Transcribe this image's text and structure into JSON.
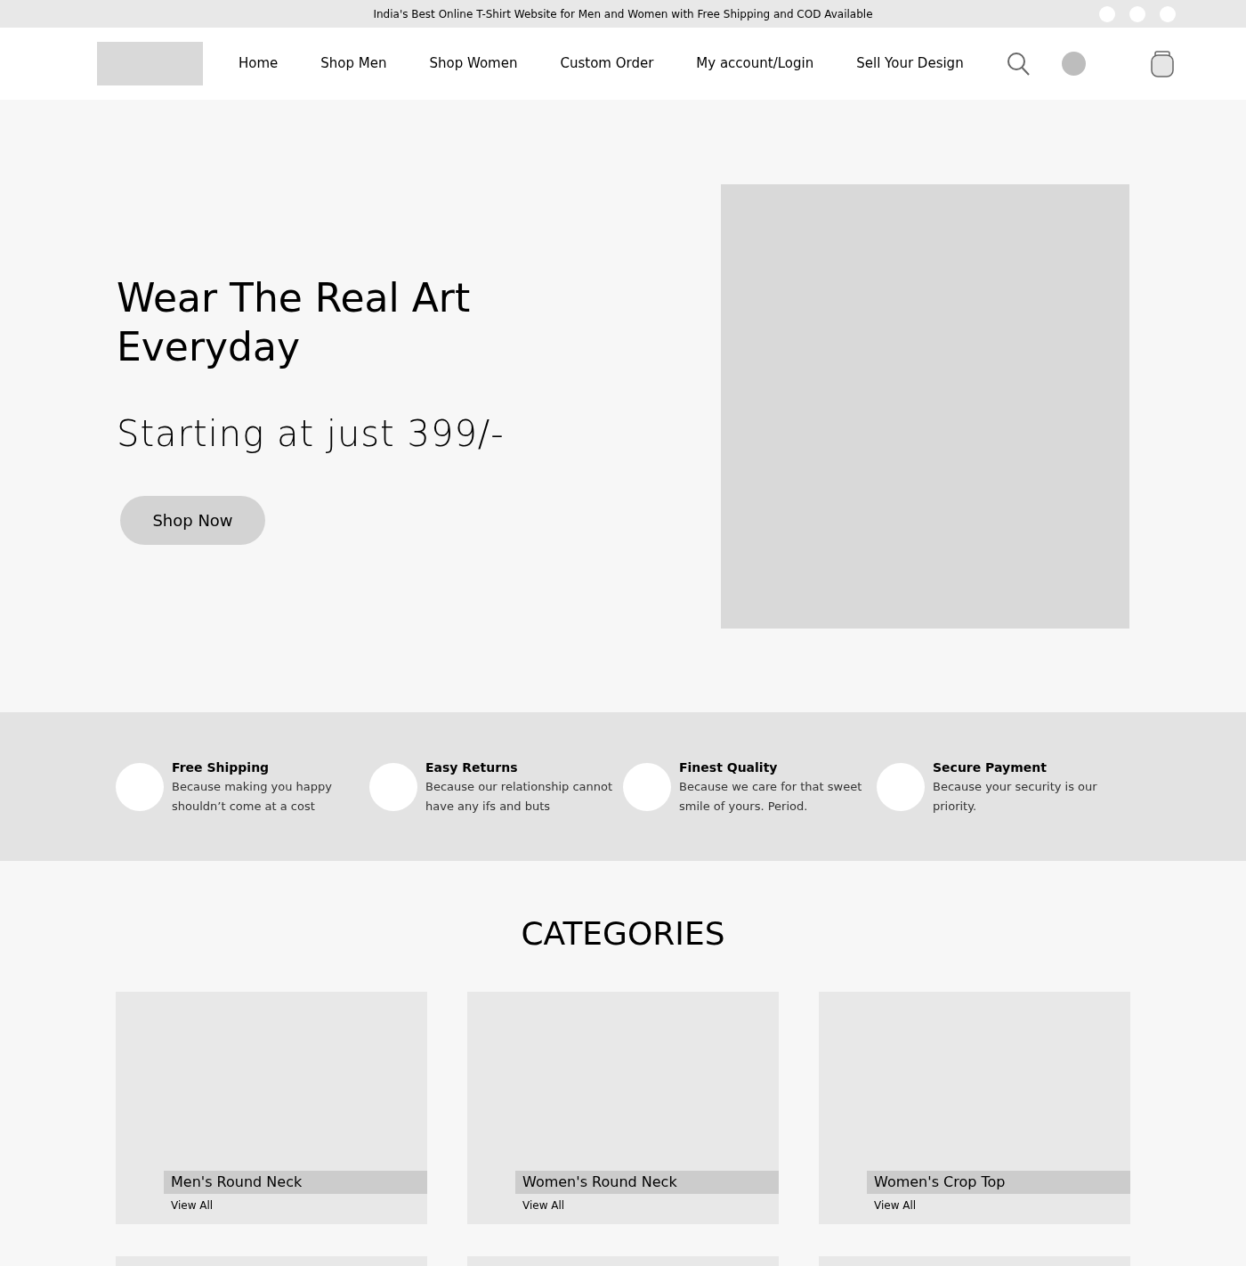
{
  "announcement": "India's Best Online T-Shirt Website for Men and Women with Free Shipping and COD Available",
  "nav": {
    "items": [
      "Home",
      "Shop Men",
      "Shop Women",
      "Custom Order",
      "My account/Login",
      "Sell Your Design"
    ]
  },
  "hero": {
    "title": "Wear The Real Art Everyday",
    "subtitle": "Starting at just 399/-",
    "button": "Shop Now"
  },
  "features": [
    {
      "title": "Free Shipping",
      "text": "Because making you happy shouldn’t come at a cost"
    },
    {
      "title": "Easy Returns",
      "text": "Because our relationship cannot have any ifs and buts"
    },
    {
      "title": "Finest Quality",
      "text": "Because we care for that sweet smile of yours. Period."
    },
    {
      "title": "Secure Payment",
      "text": "Because your security is our priority."
    }
  ],
  "categories": {
    "heading": "CATEGORIES",
    "items": [
      {
        "name": "Men's Round Neck",
        "link": "View All"
      },
      {
        "name": "Women's Round Neck",
        "link": "View All"
      },
      {
        "name": "Women's Crop Top",
        "link": "View All"
      }
    ]
  }
}
